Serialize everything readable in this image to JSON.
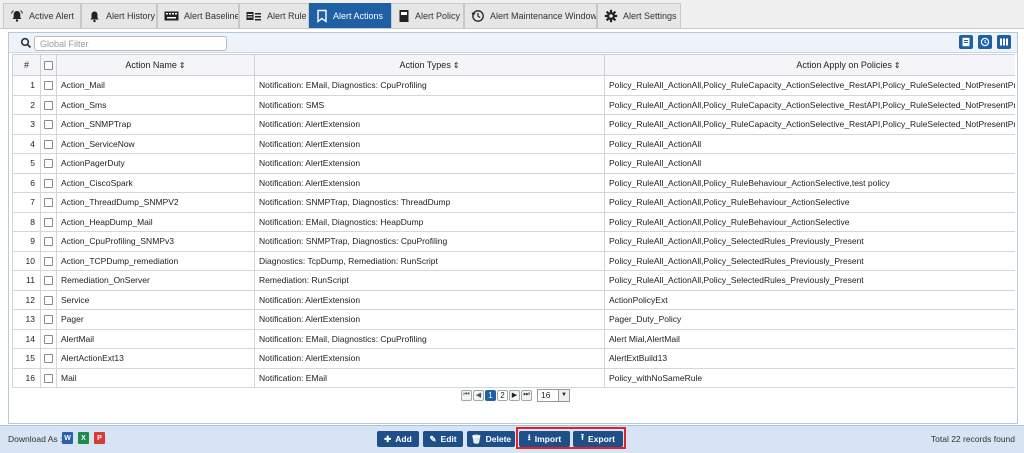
{
  "tabs": [
    {
      "label": "Active Alert",
      "icon": "alarm-bell-icon"
    },
    {
      "label": "Alert History",
      "icon": "bell-icon"
    },
    {
      "label": "Alert Baseline",
      "icon": "keyboard-icon"
    },
    {
      "label": "Alert Rule",
      "icon": "rule-list-icon"
    },
    {
      "label": "Alert Actions",
      "icon": "bookmark-icon",
      "active": true
    },
    {
      "label": "Alert Policy",
      "icon": "policy-doc-icon"
    },
    {
      "label": "Alert Maintenance Window",
      "icon": "clock-history-icon"
    },
    {
      "label": "Alert Settings",
      "icon": "gear-icon"
    }
  ],
  "filter": {
    "placeholder": "Global Filter",
    "value": ""
  },
  "toolbar_icons": [
    "report-icon",
    "history-icon",
    "columns-icon"
  ],
  "table": {
    "headers": {
      "num": "#",
      "name": "Action Name",
      "types": "Action Types",
      "policies": "Action Apply on Policies"
    },
    "rows": [
      {
        "num": "1",
        "name": "Action_Mail",
        "types": "Notification: EMail, Diagnostics: CpuProfiling",
        "policies": "Policy_RuleAll_ActionAll,Policy_RuleCapacity_ActionSelective_RestAPI,Policy_RuleSelected_NotPresentPrevio"
      },
      {
        "num": "2",
        "name": "Action_Sms",
        "types": "Notification: SMS",
        "policies": "Policy_RuleAll_ActionAll,Policy_RuleCapacity_ActionSelective_RestAPI,Policy_RuleSelected_NotPresentPrevio"
      },
      {
        "num": "3",
        "name": "Action_SNMPTrap",
        "types": "Notification: AlertExtension",
        "policies": "Policy_RuleAll_ActionAll,Policy_RuleCapacity_ActionSelective_RestAPI,Policy_RuleSelected_NotPresentPrevio"
      },
      {
        "num": "4",
        "name": "Action_ServiceNow",
        "types": "Notification: AlertExtension",
        "policies": "Policy_RuleAll_ActionAll"
      },
      {
        "num": "5",
        "name": "ActionPagerDuty",
        "types": "Notification: AlertExtension",
        "policies": "Policy_RuleAll_ActionAll"
      },
      {
        "num": "6",
        "name": "Action_CiscoSpark",
        "types": "Notification: AlertExtension",
        "policies": "Policy_RuleAll_ActionAll,Policy_RuleBehaviour_ActionSelective,test policy"
      },
      {
        "num": "7",
        "name": "Action_ThreadDump_SNMPV2",
        "types": "Notification: SNMPTrap, Diagnostics: ThreadDump",
        "policies": "Policy_RuleAll_ActionAll,Policy_RuleBehaviour_ActionSelective"
      },
      {
        "num": "8",
        "name": "Action_HeapDump_Mail",
        "types": "Notification: EMail, Diagnostics: HeapDump",
        "policies": "Policy_RuleAll_ActionAll,Policy_RuleBehaviour_ActionSelective"
      },
      {
        "num": "9",
        "name": "Action_CpuProfiling_SNMPv3",
        "types": "Notification: SNMPTrap, Diagnostics: CpuProfiling",
        "policies": "Policy_RuleAll_ActionAll,Policy_SelectedRules_Previously_Present"
      },
      {
        "num": "10",
        "name": "Action_TCPDump_remediation",
        "types": "Diagnostics: TcpDump, Remediation: RunScript",
        "policies": "Policy_RuleAll_ActionAll,Policy_SelectedRules_Previously_Present"
      },
      {
        "num": "11",
        "name": "Remediation_OnServer",
        "types": "Remediation: RunScript",
        "policies": "Policy_RuleAll_ActionAll,Policy_SelectedRules_Previously_Present"
      },
      {
        "num": "12",
        "name": "Service",
        "types": "Notification: AlertExtension",
        "policies": "ActionPolicyExt"
      },
      {
        "num": "13",
        "name": "Pager",
        "types": "Notification: AlertExtension",
        "policies": "Pager_Duty_Policy"
      },
      {
        "num": "14",
        "name": "AlertMail",
        "types": "Notification: EMail, Diagnostics: CpuProfiling",
        "policies": "Alert Mial,AlertMail"
      },
      {
        "num": "15",
        "name": "AlertActionExt13",
        "types": "Notification: AlertExtension",
        "policies": "AlertExtBuild13"
      },
      {
        "num": "16",
        "name": "Mail",
        "types": "Notification: EMail",
        "policies": "Policy_withNoSameRule"
      }
    ]
  },
  "pager": {
    "pages": [
      "1",
      "2"
    ],
    "current": "1",
    "page_size": "16"
  },
  "bottom": {
    "download_label": "Download As :",
    "download_formats": [
      {
        "icon": "word-file-icon",
        "color": "#2b5fb0",
        "glyph": "W"
      },
      {
        "icon": "excel-file-icon",
        "color": "#1f8a4c",
        "glyph": "X"
      },
      {
        "icon": "pdf-file-icon",
        "color": "#d83a3a",
        "glyph": "P"
      }
    ],
    "buttons": {
      "add": "Add",
      "edit": "Edit",
      "delete": "Delete",
      "import": "Import",
      "export": "Export"
    },
    "total": "Total 22 records found"
  },
  "colors": {
    "accent": "#1f5fa4",
    "button": "#1f4f88",
    "highlight": "#d8262b"
  }
}
